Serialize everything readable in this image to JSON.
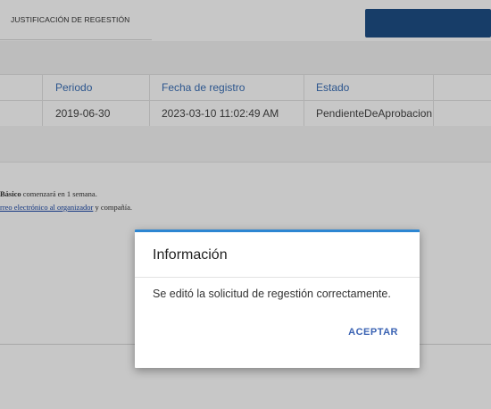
{
  "header": {
    "tab_title": "JUSTIFICACIÓN DE REGESTIÓN"
  },
  "table": {
    "columns": [
      "Periodo",
      "Fecha de registro",
      "Estado"
    ],
    "rows": [
      [
        "2019-06-30",
        "2023-03-10 11:02:49 AM",
        "PendienteDeAprobacion"
      ]
    ]
  },
  "notes": {
    "line1_bold": "Básico",
    "line1_rest": " comenzará en 1 semana.",
    "line2_link": "rreo electrónico al organizador",
    "line2_rest": " y compañía."
  },
  "dialog": {
    "title": "Información",
    "message": "Se editó la solicitud de regestión correctamente.",
    "accept_label": "ACEPTAR"
  },
  "colors": {
    "header_accent": "#1e4f86",
    "dialog_top_border": "#2c86d2",
    "button_text": "#3b63b3"
  }
}
